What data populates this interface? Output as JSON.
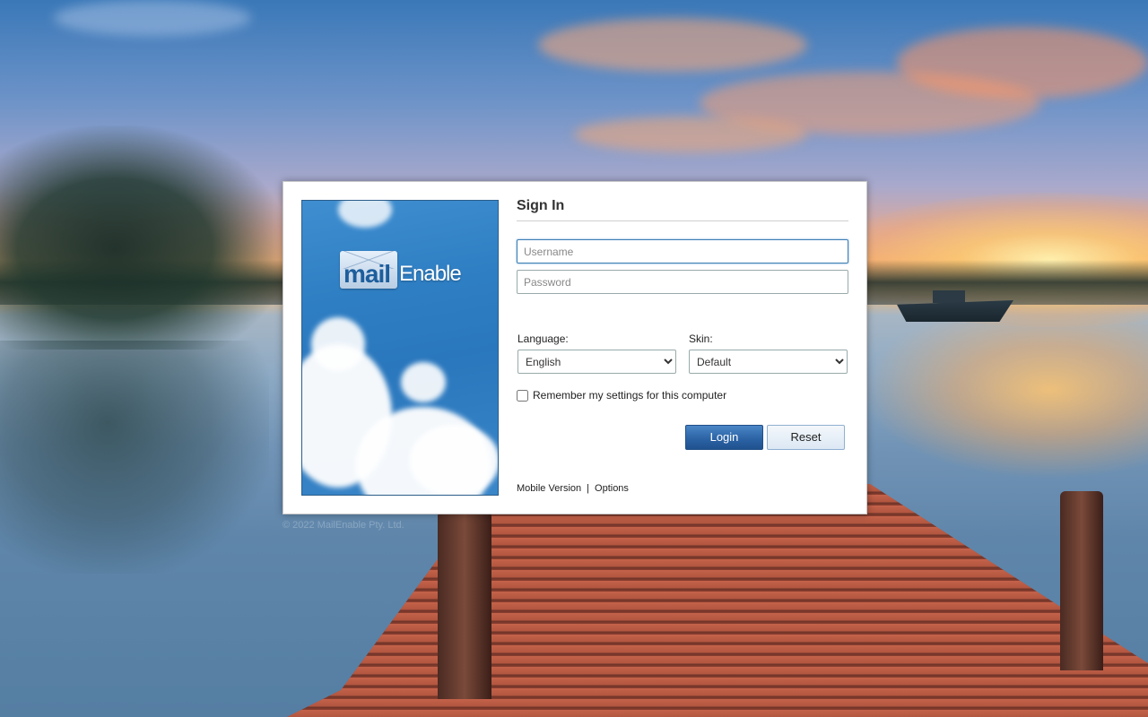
{
  "signin": {
    "title": "Sign In",
    "username_placeholder": "Username",
    "password_placeholder": "Password",
    "language_label": "Language:",
    "language_value": "English",
    "skin_label": "Skin:",
    "skin_value": "Default",
    "remember_label": "Remember my settings for this computer",
    "remember_checked": false,
    "login_label": "Login",
    "reset_label": "Reset"
  },
  "links": {
    "mobile": "Mobile Version",
    "separator": "|",
    "options": "Options"
  },
  "brand": {
    "logo_mail": "mail",
    "logo_enable": "Enable"
  },
  "footer": {
    "copyright": "© 2022 MailEnable Pty. Ltd."
  },
  "colors": {
    "login_button": "#2c64a6",
    "focus_border": "#3c7fb5"
  }
}
